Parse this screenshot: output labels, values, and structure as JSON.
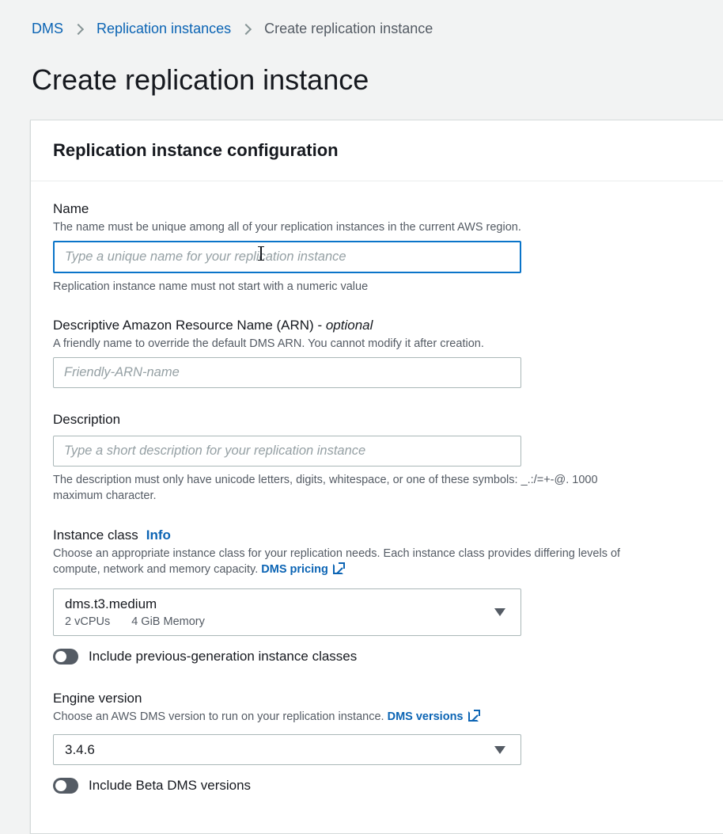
{
  "breadcrumb": {
    "items": [
      "DMS",
      "Replication instances"
    ],
    "current": "Create replication instance"
  },
  "page_title": "Create replication instance",
  "panel": {
    "title": "Replication instance configuration"
  },
  "name_field": {
    "label": "Name",
    "description": "The name must be unique among all of your replication instances in the current AWS region.",
    "placeholder": "Type a unique name for your replication instance",
    "value": "",
    "hint": "Replication instance name must not start with a numeric value"
  },
  "arn_field": {
    "label": "Descriptive Amazon Resource Name (ARN) - ",
    "label_optional": "optional",
    "description": "A friendly name to override the default DMS ARN. You cannot modify it after creation.",
    "placeholder": "Friendly-ARN-name",
    "value": ""
  },
  "description_field": {
    "label": "Description",
    "placeholder": "Type a short description for your replication instance",
    "value": "",
    "hint_line1": "The description must only have unicode letters, digits, whitespace, or one of these symbols: _.:/=+-@. 1000",
    "hint_line2": "maximum character."
  },
  "instance_class": {
    "label": "Instance class",
    "info_link": "Info",
    "description_line1": "Choose an appropriate instance class for your replication needs. Each instance class provides differing levels of",
    "description_line2": "compute, network and memory capacity. ",
    "pricing_link": "DMS pricing",
    "selected": "dms.t3.medium",
    "vcpus": "2 vCPUs",
    "memory": "4 GiB Memory",
    "toggle_label": "Include previous-generation instance classes",
    "toggle_on": false
  },
  "engine_version": {
    "label": "Engine version",
    "description": "Choose an AWS DMS version to run on your replication instance. ",
    "versions_link": "DMS versions",
    "selected": "3.4.6",
    "toggle_label": "Include Beta DMS versions",
    "toggle_on": false
  },
  "colors": {
    "link": "#0b64b4",
    "focus_border": "#0a74c9",
    "background": "#f2f3f3"
  }
}
